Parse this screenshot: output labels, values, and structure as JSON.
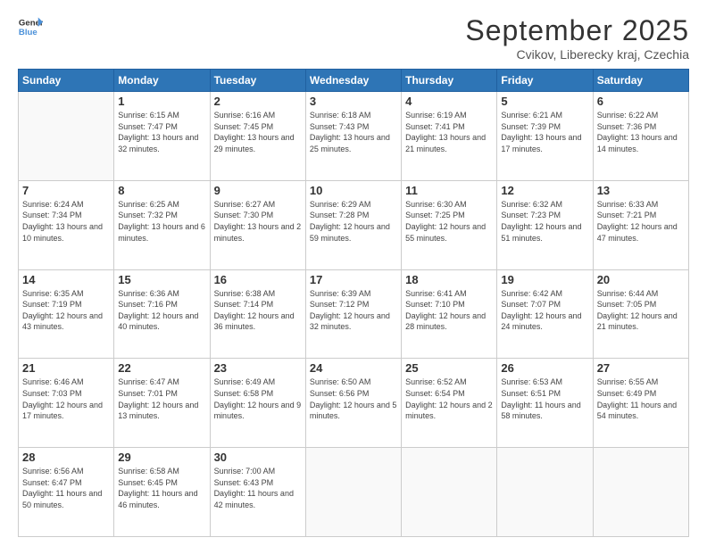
{
  "header": {
    "logo_line1": "General",
    "logo_line2": "Blue",
    "month": "September 2025",
    "location": "Cvikov, Liberecky kraj, Czechia"
  },
  "weekdays": [
    "Sunday",
    "Monday",
    "Tuesday",
    "Wednesday",
    "Thursday",
    "Friday",
    "Saturday"
  ],
  "weeks": [
    [
      {
        "day": "",
        "sunrise": "",
        "sunset": "",
        "daylight": ""
      },
      {
        "day": "1",
        "sunrise": "Sunrise: 6:15 AM",
        "sunset": "Sunset: 7:47 PM",
        "daylight": "Daylight: 13 hours and 32 minutes."
      },
      {
        "day": "2",
        "sunrise": "Sunrise: 6:16 AM",
        "sunset": "Sunset: 7:45 PM",
        "daylight": "Daylight: 13 hours and 29 minutes."
      },
      {
        "day": "3",
        "sunrise": "Sunrise: 6:18 AM",
        "sunset": "Sunset: 7:43 PM",
        "daylight": "Daylight: 13 hours and 25 minutes."
      },
      {
        "day": "4",
        "sunrise": "Sunrise: 6:19 AM",
        "sunset": "Sunset: 7:41 PM",
        "daylight": "Daylight: 13 hours and 21 minutes."
      },
      {
        "day": "5",
        "sunrise": "Sunrise: 6:21 AM",
        "sunset": "Sunset: 7:39 PM",
        "daylight": "Daylight: 13 hours and 17 minutes."
      },
      {
        "day": "6",
        "sunrise": "Sunrise: 6:22 AM",
        "sunset": "Sunset: 7:36 PM",
        "daylight": "Daylight: 13 hours and 14 minutes."
      }
    ],
    [
      {
        "day": "7",
        "sunrise": "Sunrise: 6:24 AM",
        "sunset": "Sunset: 7:34 PM",
        "daylight": "Daylight: 13 hours and 10 minutes."
      },
      {
        "day": "8",
        "sunrise": "Sunrise: 6:25 AM",
        "sunset": "Sunset: 7:32 PM",
        "daylight": "Daylight: 13 hours and 6 minutes."
      },
      {
        "day": "9",
        "sunrise": "Sunrise: 6:27 AM",
        "sunset": "Sunset: 7:30 PM",
        "daylight": "Daylight: 13 hours and 2 minutes."
      },
      {
        "day": "10",
        "sunrise": "Sunrise: 6:29 AM",
        "sunset": "Sunset: 7:28 PM",
        "daylight": "Daylight: 12 hours and 59 minutes."
      },
      {
        "day": "11",
        "sunrise": "Sunrise: 6:30 AM",
        "sunset": "Sunset: 7:25 PM",
        "daylight": "Daylight: 12 hours and 55 minutes."
      },
      {
        "day": "12",
        "sunrise": "Sunrise: 6:32 AM",
        "sunset": "Sunset: 7:23 PM",
        "daylight": "Daylight: 12 hours and 51 minutes."
      },
      {
        "day": "13",
        "sunrise": "Sunrise: 6:33 AM",
        "sunset": "Sunset: 7:21 PM",
        "daylight": "Daylight: 12 hours and 47 minutes."
      }
    ],
    [
      {
        "day": "14",
        "sunrise": "Sunrise: 6:35 AM",
        "sunset": "Sunset: 7:19 PM",
        "daylight": "Daylight: 12 hours and 43 minutes."
      },
      {
        "day": "15",
        "sunrise": "Sunrise: 6:36 AM",
        "sunset": "Sunset: 7:16 PM",
        "daylight": "Daylight: 12 hours and 40 minutes."
      },
      {
        "day": "16",
        "sunrise": "Sunrise: 6:38 AM",
        "sunset": "Sunset: 7:14 PM",
        "daylight": "Daylight: 12 hours and 36 minutes."
      },
      {
        "day": "17",
        "sunrise": "Sunrise: 6:39 AM",
        "sunset": "Sunset: 7:12 PM",
        "daylight": "Daylight: 12 hours and 32 minutes."
      },
      {
        "day": "18",
        "sunrise": "Sunrise: 6:41 AM",
        "sunset": "Sunset: 7:10 PM",
        "daylight": "Daylight: 12 hours and 28 minutes."
      },
      {
        "day": "19",
        "sunrise": "Sunrise: 6:42 AM",
        "sunset": "Sunset: 7:07 PM",
        "daylight": "Daylight: 12 hours and 24 minutes."
      },
      {
        "day": "20",
        "sunrise": "Sunrise: 6:44 AM",
        "sunset": "Sunset: 7:05 PM",
        "daylight": "Daylight: 12 hours and 21 minutes."
      }
    ],
    [
      {
        "day": "21",
        "sunrise": "Sunrise: 6:46 AM",
        "sunset": "Sunset: 7:03 PM",
        "daylight": "Daylight: 12 hours and 17 minutes."
      },
      {
        "day": "22",
        "sunrise": "Sunrise: 6:47 AM",
        "sunset": "Sunset: 7:01 PM",
        "daylight": "Daylight: 12 hours and 13 minutes."
      },
      {
        "day": "23",
        "sunrise": "Sunrise: 6:49 AM",
        "sunset": "Sunset: 6:58 PM",
        "daylight": "Daylight: 12 hours and 9 minutes."
      },
      {
        "day": "24",
        "sunrise": "Sunrise: 6:50 AM",
        "sunset": "Sunset: 6:56 PM",
        "daylight": "Daylight: 12 hours and 5 minutes."
      },
      {
        "day": "25",
        "sunrise": "Sunrise: 6:52 AM",
        "sunset": "Sunset: 6:54 PM",
        "daylight": "Daylight: 12 hours and 2 minutes."
      },
      {
        "day": "26",
        "sunrise": "Sunrise: 6:53 AM",
        "sunset": "Sunset: 6:51 PM",
        "daylight": "Daylight: 11 hours and 58 minutes."
      },
      {
        "day": "27",
        "sunrise": "Sunrise: 6:55 AM",
        "sunset": "Sunset: 6:49 PM",
        "daylight": "Daylight: 11 hours and 54 minutes."
      }
    ],
    [
      {
        "day": "28",
        "sunrise": "Sunrise: 6:56 AM",
        "sunset": "Sunset: 6:47 PM",
        "daylight": "Daylight: 11 hours and 50 minutes."
      },
      {
        "day": "29",
        "sunrise": "Sunrise: 6:58 AM",
        "sunset": "Sunset: 6:45 PM",
        "daylight": "Daylight: 11 hours and 46 minutes."
      },
      {
        "day": "30",
        "sunrise": "Sunrise: 7:00 AM",
        "sunset": "Sunset: 6:43 PM",
        "daylight": "Daylight: 11 hours and 42 minutes."
      },
      {
        "day": "",
        "sunrise": "",
        "sunset": "",
        "daylight": ""
      },
      {
        "day": "",
        "sunrise": "",
        "sunset": "",
        "daylight": ""
      },
      {
        "day": "",
        "sunrise": "",
        "sunset": "",
        "daylight": ""
      },
      {
        "day": "",
        "sunrise": "",
        "sunset": "",
        "daylight": ""
      }
    ]
  ]
}
